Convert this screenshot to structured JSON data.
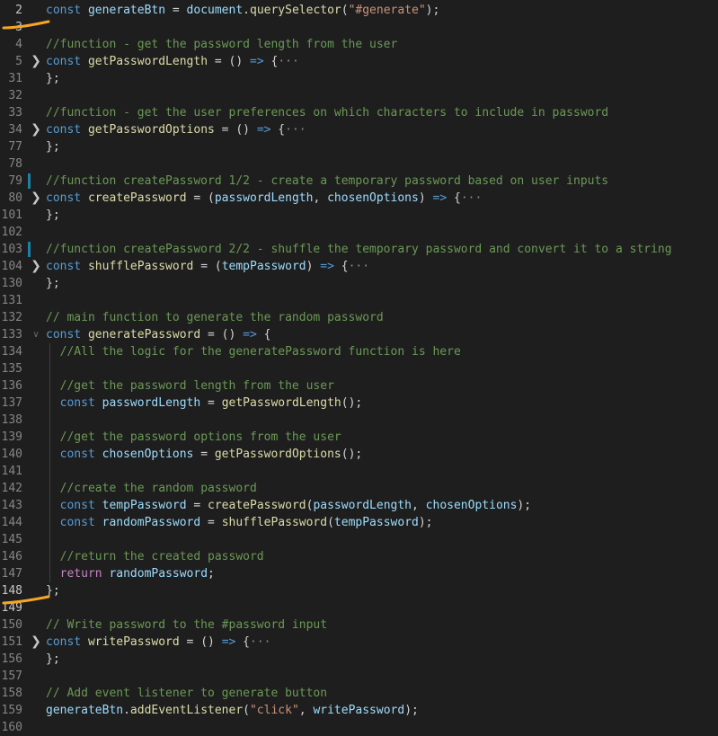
{
  "colors": {
    "background": "#1e1e1e",
    "keyword": "#569cd6",
    "control_keyword": "#c586c0",
    "variable": "#9cdcfe",
    "function": "#dcdcaa",
    "string": "#ce9178",
    "comment": "#6a9955",
    "line_number": "#858585",
    "modified_marker": "#1b81a8",
    "annotation_stroke": "#f5a623"
  },
  "lines": [
    {
      "num": "2",
      "current": true,
      "tokens": [
        {
          "t": "const",
          "c": "kw"
        },
        {
          "t": " "
        },
        {
          "t": "generateBtn",
          "c": "var"
        },
        {
          "t": " = "
        },
        {
          "t": "document",
          "c": "var"
        },
        {
          "t": "."
        },
        {
          "t": "querySelector",
          "c": "fn"
        },
        {
          "t": "("
        },
        {
          "t": "\"#generate\"",
          "c": "str"
        },
        {
          "t": ");"
        }
      ]
    },
    {
      "num": "3",
      "current": true,
      "tokens": []
    },
    {
      "num": "4",
      "tokens": [
        {
          "t": "//function - get the password length from the user",
          "c": "cm"
        }
      ]
    },
    {
      "num": "5",
      "fold": "collapsed",
      "tokens": [
        {
          "t": "const",
          "c": "kw"
        },
        {
          "t": " "
        },
        {
          "t": "getPasswordLength",
          "c": "fn"
        },
        {
          "t": " = () "
        },
        {
          "t": "=>",
          "c": "kw"
        },
        {
          "t": " {"
        },
        {
          "t": "···",
          "c": "ellipsis"
        }
      ]
    },
    {
      "num": "31",
      "tokens": [
        {
          "t": "};"
        }
      ]
    },
    {
      "num": "32",
      "tokens": []
    },
    {
      "num": "33",
      "tokens": [
        {
          "t": "//function - get the user preferences on which characters to include in password",
          "c": "cm"
        }
      ]
    },
    {
      "num": "34",
      "fold": "collapsed",
      "tokens": [
        {
          "t": "const",
          "c": "kw"
        },
        {
          "t": " "
        },
        {
          "t": "getPasswordOptions",
          "c": "fn"
        },
        {
          "t": " = () "
        },
        {
          "t": "=>",
          "c": "kw"
        },
        {
          "t": " {"
        },
        {
          "t": "···",
          "c": "ellipsis"
        }
      ]
    },
    {
      "num": "77",
      "tokens": [
        {
          "t": "};"
        }
      ]
    },
    {
      "num": "78",
      "tokens": []
    },
    {
      "num": "79",
      "marker": true,
      "tokens": [
        {
          "t": "//function createPassword 1/2 - create a temporary password based on user inputs",
          "c": "cm"
        }
      ]
    },
    {
      "num": "80",
      "fold": "collapsed",
      "tokens": [
        {
          "t": "const",
          "c": "kw"
        },
        {
          "t": " "
        },
        {
          "t": "createPassword",
          "c": "fn"
        },
        {
          "t": " = ("
        },
        {
          "t": "passwordLength",
          "c": "var"
        },
        {
          "t": ", "
        },
        {
          "t": "chosenOptions",
          "c": "var"
        },
        {
          "t": ") "
        },
        {
          "t": "=>",
          "c": "kw"
        },
        {
          "t": " {"
        },
        {
          "t": "···",
          "c": "ellipsis"
        }
      ]
    },
    {
      "num": "101",
      "tokens": [
        {
          "t": "};"
        }
      ]
    },
    {
      "num": "102",
      "tokens": []
    },
    {
      "num": "103",
      "marker": true,
      "tokens": [
        {
          "t": "//function createPassword 2/2 - shuffle the temporary password and convert it to a string",
          "c": "cm"
        }
      ]
    },
    {
      "num": "104",
      "fold": "collapsed",
      "tokens": [
        {
          "t": "const",
          "c": "kw"
        },
        {
          "t": " "
        },
        {
          "t": "shufflePassword",
          "c": "fn"
        },
        {
          "t": " = ("
        },
        {
          "t": "tempPassword",
          "c": "var"
        },
        {
          "t": ") "
        },
        {
          "t": "=>",
          "c": "kw"
        },
        {
          "t": " {"
        },
        {
          "t": "···",
          "c": "ellipsis"
        }
      ]
    },
    {
      "num": "130",
      "tokens": [
        {
          "t": "};"
        }
      ]
    },
    {
      "num": "131",
      "tokens": []
    },
    {
      "num": "132",
      "tokens": [
        {
          "t": "// main function to generate the random password",
          "c": "cm"
        }
      ]
    },
    {
      "num": "133",
      "fold": "expanded",
      "tokens": [
        {
          "t": "const",
          "c": "kw"
        },
        {
          "t": " "
        },
        {
          "t": "generatePassword",
          "c": "fn"
        },
        {
          "t": " = () "
        },
        {
          "t": "=>",
          "c": "kw"
        },
        {
          "t": " {"
        }
      ]
    },
    {
      "num": "134",
      "guide": true,
      "tokens": [
        {
          "t": "  "
        },
        {
          "t": "//All the logic for the generatePassword function is here",
          "c": "cm"
        }
      ]
    },
    {
      "num": "135",
      "guide": true,
      "tokens": []
    },
    {
      "num": "136",
      "guide": true,
      "tokens": [
        {
          "t": "  "
        },
        {
          "t": "//get the password length from the user",
          "c": "cm"
        }
      ]
    },
    {
      "num": "137",
      "guide": true,
      "tokens": [
        {
          "t": "  "
        },
        {
          "t": "const",
          "c": "kw"
        },
        {
          "t": " "
        },
        {
          "t": "passwordLength",
          "c": "var"
        },
        {
          "t": " = "
        },
        {
          "t": "getPasswordLength",
          "c": "fn"
        },
        {
          "t": "();"
        }
      ]
    },
    {
      "num": "138",
      "guide": true,
      "tokens": []
    },
    {
      "num": "139",
      "guide": true,
      "tokens": [
        {
          "t": "  "
        },
        {
          "t": "//get the password options from the user",
          "c": "cm"
        }
      ]
    },
    {
      "num": "140",
      "guide": true,
      "tokens": [
        {
          "t": "  "
        },
        {
          "t": "const",
          "c": "kw"
        },
        {
          "t": " "
        },
        {
          "t": "chosenOptions",
          "c": "var"
        },
        {
          "t": " = "
        },
        {
          "t": "getPasswordOptions",
          "c": "fn"
        },
        {
          "t": "();"
        }
      ]
    },
    {
      "num": "141",
      "guide": true,
      "tokens": []
    },
    {
      "num": "142",
      "guide": true,
      "tokens": [
        {
          "t": "  "
        },
        {
          "t": "//create the random password",
          "c": "cm"
        }
      ]
    },
    {
      "num": "143",
      "guide": true,
      "tokens": [
        {
          "t": "  "
        },
        {
          "t": "const",
          "c": "kw"
        },
        {
          "t": " "
        },
        {
          "t": "tempPassword",
          "c": "var"
        },
        {
          "t": " = "
        },
        {
          "t": "createPassword",
          "c": "fn"
        },
        {
          "t": "("
        },
        {
          "t": "passwordLength",
          "c": "var"
        },
        {
          "t": ", "
        },
        {
          "t": "chosenOptions",
          "c": "var"
        },
        {
          "t": ");"
        }
      ]
    },
    {
      "num": "144",
      "guide": true,
      "tokens": [
        {
          "t": "  "
        },
        {
          "t": "const",
          "c": "kw"
        },
        {
          "t": " "
        },
        {
          "t": "randomPassword",
          "c": "var"
        },
        {
          "t": " = "
        },
        {
          "t": "shufflePassword",
          "c": "fn"
        },
        {
          "t": "("
        },
        {
          "t": "tempPassword",
          "c": "var"
        },
        {
          "t": ");"
        }
      ]
    },
    {
      "num": "145",
      "guide": true,
      "tokens": []
    },
    {
      "num": "146",
      "guide": true,
      "tokens": [
        {
          "t": "  "
        },
        {
          "t": "//return the created password",
          "c": "cm"
        }
      ]
    },
    {
      "num": "147",
      "guide": true,
      "tokens": [
        {
          "t": "  "
        },
        {
          "t": "return",
          "c": "ctl"
        },
        {
          "t": " "
        },
        {
          "t": "randomPassword",
          "c": "var"
        },
        {
          "t": ";"
        }
      ]
    },
    {
      "num": "148",
      "current": true,
      "tokens": [
        {
          "t": "};"
        }
      ]
    },
    {
      "num": "149",
      "current": true,
      "tokens": []
    },
    {
      "num": "150",
      "tokens": [
        {
          "t": "// Write password to the #password input",
          "c": "cm"
        }
      ]
    },
    {
      "num": "151",
      "fold": "collapsed",
      "tokens": [
        {
          "t": "const",
          "c": "kw"
        },
        {
          "t": " "
        },
        {
          "t": "writePassword",
          "c": "fn"
        },
        {
          "t": " = () "
        },
        {
          "t": "=>",
          "c": "kw"
        },
        {
          "t": " {"
        },
        {
          "t": "···",
          "c": "ellipsis"
        }
      ]
    },
    {
      "num": "156",
      "tokens": [
        {
          "t": "};"
        }
      ]
    },
    {
      "num": "157",
      "tokens": []
    },
    {
      "num": "158",
      "tokens": [
        {
          "t": "// Add event listener to generate button",
          "c": "cm"
        }
      ]
    },
    {
      "num": "159",
      "tokens": [
        {
          "t": "generateBtn",
          "c": "var"
        },
        {
          "t": "."
        },
        {
          "t": "addEventListener",
          "c": "fn"
        },
        {
          "t": "("
        },
        {
          "t": "\"click\"",
          "c": "str"
        },
        {
          "t": ", "
        },
        {
          "t": "writePassword",
          "c": "var"
        },
        {
          "t": ");"
        }
      ]
    },
    {
      "num": "160",
      "tokens": []
    }
  ]
}
